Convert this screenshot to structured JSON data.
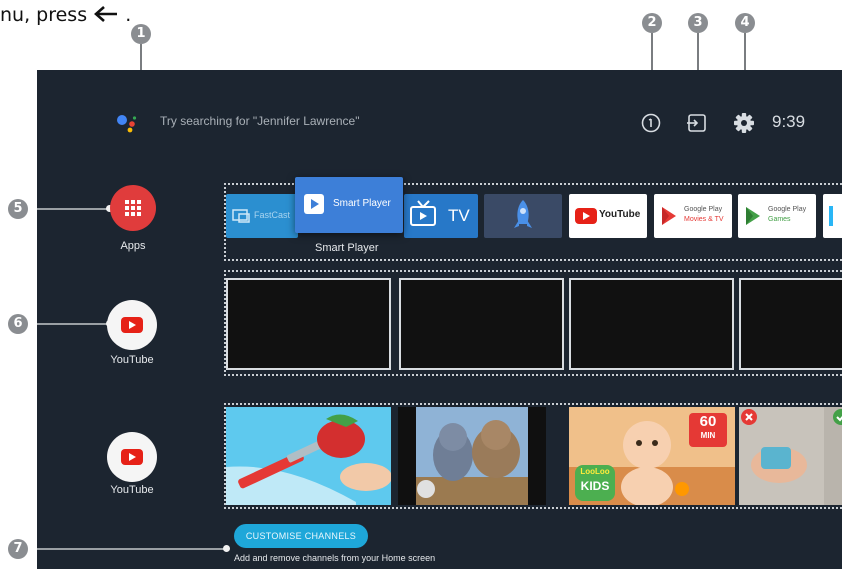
{
  "caption": {
    "text": "nu, press"
  },
  "callouts": [
    "1",
    "2",
    "3",
    "4",
    "5",
    "6",
    "7"
  ],
  "search": {
    "placeholder_text": "Try searching for \"Jennifer Lawrence\""
  },
  "status": {
    "time": "9:39"
  },
  "sidebar": {
    "apps_label": "Apps",
    "channel_1_label": "YouTube",
    "channel_2_label": "YouTube"
  },
  "app_tiles": {
    "fastcast": "FastCast",
    "smart_player": "Smart Player",
    "tv": "TV",
    "youtube": "YouTube",
    "google_play_movies": "Google Play",
    "google_play_movies_sub": "Movies & TV",
    "google_play_games": "Google Play",
    "google_play_games_sub": "Games",
    "focused_label": "Smart Player"
  },
  "thumbnails": {
    "badge_60": "60",
    "badge_min": "MIN",
    "lolo": "LooLoo",
    "kids": "KIDS"
  },
  "customise": {
    "button_label": "CUSTOMISE CHANNELS",
    "subtitle": "Add and remove channels from your Home screen"
  },
  "colors": {
    "tv_background": "#1c2530",
    "apps_red": "#e03c3c",
    "youtube_red": "#e62117",
    "smart_player_blue": "#3d7fd8",
    "accent_cyan": "#1ea7d9"
  },
  "icons": {
    "caption_arrow": "left-arrow-icon",
    "assistant": "google-assistant-icon",
    "notifications": "info-circle-icon",
    "input_source": "input-source-icon",
    "settings": "gear-icon",
    "apps": "grid-icon",
    "youtube": "youtube-play-icon"
  }
}
